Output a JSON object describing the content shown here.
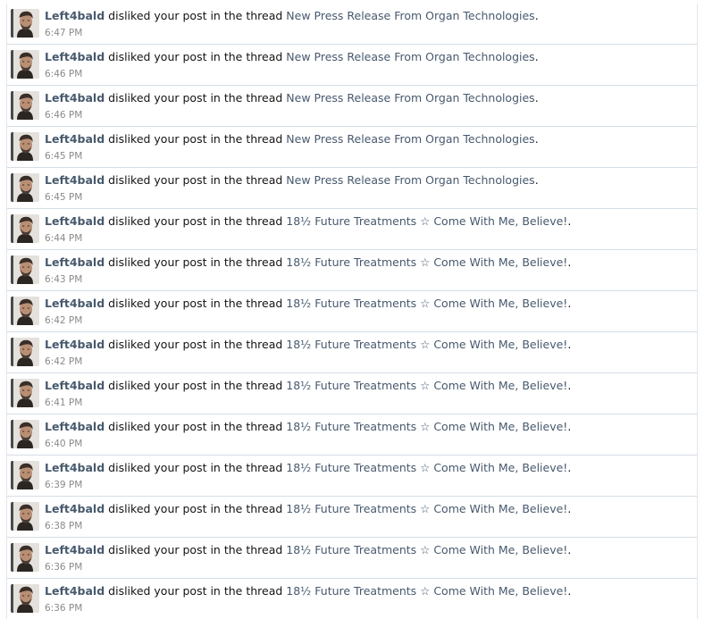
{
  "alerts": [
    {
      "user": "Left4bald",
      "action": "disliked your post in the thread",
      "thread": "New Press Release From Organ Technologies",
      "end": ".",
      "time": "6:47 PM"
    },
    {
      "user": "Left4bald",
      "action": "disliked your post in the thread",
      "thread": "New Press Release From Organ Technologies",
      "end": ".",
      "time": "6:46 PM"
    },
    {
      "user": "Left4bald",
      "action": "disliked your post in the thread",
      "thread": "New Press Release From Organ Technologies",
      "end": ".",
      "time": "6:46 PM"
    },
    {
      "user": "Left4bald",
      "action": "disliked your post in the thread",
      "thread": "New Press Release From Organ Technologies",
      "end": ".",
      "time": "6:45 PM"
    },
    {
      "user": "Left4bald",
      "action": "disliked your post in the thread",
      "thread": "New Press Release From Organ Technologies",
      "end": ".",
      "time": "6:45 PM"
    },
    {
      "user": "Left4bald",
      "action": "disliked your post in the thread",
      "thread": "18½ Future Treatments ☆ Come With Me, Believe!",
      "end": ".",
      "time": "6:44 PM"
    },
    {
      "user": "Left4bald",
      "action": "disliked your post in the thread",
      "thread": "18½ Future Treatments ☆ Come With Me, Believe!",
      "end": ".",
      "time": "6:43 PM"
    },
    {
      "user": "Left4bald",
      "action": "disliked your post in the thread",
      "thread": "18½ Future Treatments ☆ Come With Me, Believe!",
      "end": ".",
      "time": "6:42 PM"
    },
    {
      "user": "Left4bald",
      "action": "disliked your post in the thread",
      "thread": "18½ Future Treatments ☆ Come With Me, Believe!",
      "end": ".",
      "time": "6:42 PM"
    },
    {
      "user": "Left4bald",
      "action": "disliked your post in the thread",
      "thread": "18½ Future Treatments ☆ Come With Me, Believe!",
      "end": ".",
      "time": "6:41 PM"
    },
    {
      "user": "Left4bald",
      "action": "disliked your post in the thread",
      "thread": "18½ Future Treatments ☆ Come With Me, Believe!",
      "end": ".",
      "time": "6:40 PM"
    },
    {
      "user": "Left4bald",
      "action": "disliked your post in the thread",
      "thread": "18½ Future Treatments ☆ Come With Me, Believe!",
      "end": ".",
      "time": "6:39 PM"
    },
    {
      "user": "Left4bald",
      "action": "disliked your post in the thread",
      "thread": "18½ Future Treatments ☆ Come With Me, Believe!",
      "end": ".",
      "time": "6:38 PM"
    },
    {
      "user": "Left4bald",
      "action": "disliked your post in the thread",
      "thread": "18½ Future Treatments ☆ Come With Me, Believe!",
      "end": ".",
      "time": "6:36 PM"
    },
    {
      "user": "Left4bald",
      "action": "disliked your post in the thread",
      "thread": "18½ Future Treatments ☆ Come With Me, Believe!",
      "end": ".",
      "time": "6:36 PM"
    }
  ],
  "colors": {
    "link": "#47596d",
    "text": "#141414",
    "time": "#8a8a8a",
    "separator": "#d4dee6"
  },
  "icons": {
    "avatar": "user-avatar-photo"
  }
}
